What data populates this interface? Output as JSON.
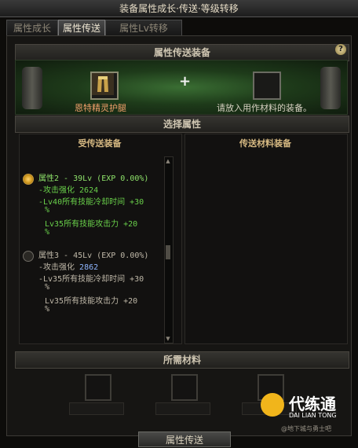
{
  "window": {
    "title": "装备属性成长·传送·等级转移"
  },
  "tabs": [
    {
      "label": "属性成长",
      "active": false
    },
    {
      "label": "属性传送",
      "active": true
    },
    {
      "label": "属性Lv转移",
      "active": false
    }
  ],
  "transfer_section": {
    "title": "属性传送装备",
    "help_icon": "?",
    "plus_symbol": "+",
    "source_item_name": "恩特精灵护腿",
    "target_placeholder": "请放入用作材料的装备。"
  },
  "select_section": {
    "title": "选择属性",
    "left_header": "受传送装备",
    "right_header": "传送材料装备",
    "options": [
      {
        "selected": true,
        "lines": [
          {
            "text": "属性2 - 39Lv (EXP 0.00%)",
            "color": "green"
          },
          {
            "text": "-攻击强化 2624",
            "color": "green"
          },
          {
            "text": "-Lv40所有技能冷却时间 +30",
            "color": "green"
          },
          {
            "text": "%",
            "color": "green"
          },
          {
            "text": "Lv35所有技能攻击力 +20",
            "color": "green"
          },
          {
            "text": "%",
            "color": "green"
          }
        ]
      },
      {
        "selected": false,
        "lines": [
          {
            "text": "属性3 - 45Lv (EXP 0.00%)",
            "color": "white"
          },
          {
            "text": "-攻击强化 2862",
            "color": "white",
            "highlight": "2862"
          },
          {
            "text": "-Lv35所有技能冷却时间 +30",
            "color": "white"
          },
          {
            "text": "%",
            "color": "white"
          },
          {
            "text": "Lv35所有技能攻击力 +20",
            "color": "white"
          },
          {
            "text": "%",
            "color": "white"
          }
        ]
      }
    ]
  },
  "materials_section": {
    "title": "所需材料"
  },
  "bottom_button": {
    "label": "属性传送"
  },
  "watermark": {
    "brand": "代练通",
    "brand_en": "DAI LIAN TONG",
    "caption": "@地下城与勇士吧"
  }
}
